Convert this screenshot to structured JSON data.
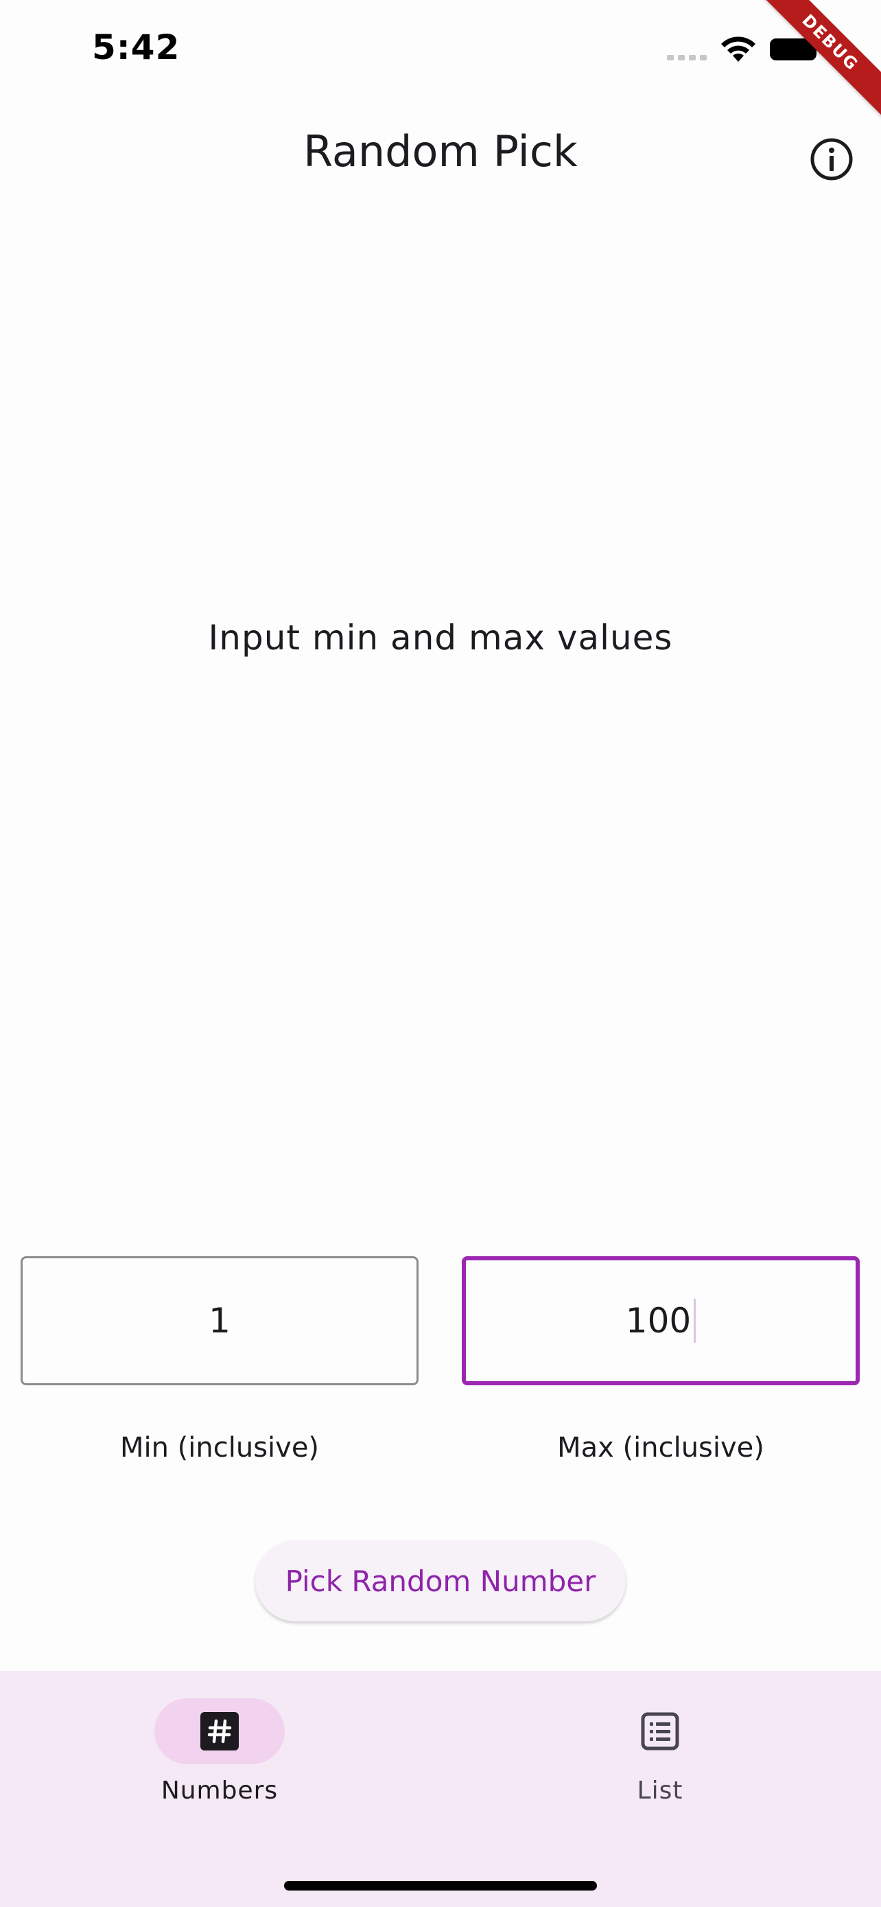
{
  "status_bar": {
    "time": "5:42",
    "debug_label": "DEBUG"
  },
  "app_bar": {
    "title": "Random Pick",
    "info_icon": "info-icon"
  },
  "main": {
    "prompt": "Input min and max values"
  },
  "inputs": {
    "min": {
      "value": "1",
      "label": "Min (inclusive)"
    },
    "max": {
      "value": "100",
      "label": "Max (inclusive)",
      "focused": true
    }
  },
  "action": {
    "pick_label": "Pick Random Number"
  },
  "bottom_nav": {
    "items": [
      {
        "label": "Numbers",
        "icon": "hash-icon",
        "selected": true
      },
      {
        "label": "List",
        "icon": "list-icon",
        "selected": false
      }
    ]
  },
  "colors": {
    "accent": "#9c27b0",
    "nav_background": "#f5e9f6",
    "nav_indicator": "#f2d3ef",
    "debug_banner": "#b71c1c"
  }
}
